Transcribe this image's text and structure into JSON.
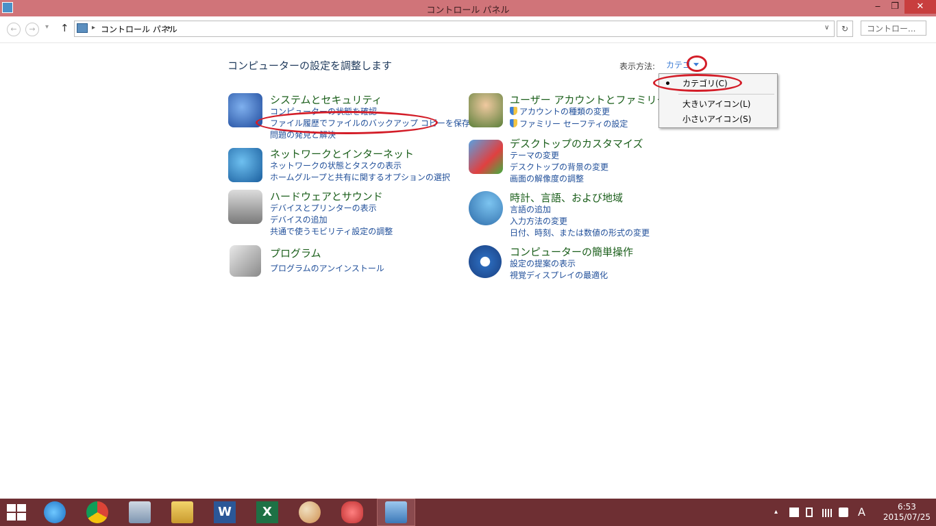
{
  "window": {
    "title": "コントロール パネル",
    "minimize": "‒",
    "restore": "❐",
    "close": "✕"
  },
  "navbar": {
    "back": "←",
    "forward": "→",
    "recent": "▾",
    "up": "↑",
    "breadcrumb_sep": "▸",
    "breadcrumb": "コントロール パネル",
    "address_dropdown": "∨",
    "refresh": "↻",
    "search_placeholder": "コントロー..."
  },
  "heading": "コンピューターの設定を調整します",
  "viewby": {
    "label": "表示方法:",
    "value": "カテゴ",
    "options": [
      "カテゴリ(C)",
      "大きいアイコン(L)",
      "小さいアイコン(S)"
    ],
    "selected_index": 0
  },
  "categories": [
    {
      "title": "システムとセキュリティ",
      "links": [
        "コンピューターの状態を確認",
        "ファイル履歴でファイルのバックアップ コピーを保存",
        "問題の発見と解決"
      ]
    },
    {
      "title": "ネットワークとインターネット",
      "links": [
        "ネットワークの状態とタスクの表示",
        "ホームグループと共有に関するオプションの選択"
      ]
    },
    {
      "title": "ハードウェアとサウンド",
      "links": [
        "デバイスとプリンターの表示",
        "デバイスの追加",
        "共通で使うモビリティ設定の調整"
      ]
    },
    {
      "title": "プログラム",
      "links": [
        "プログラムのアンインストール"
      ]
    },
    {
      "title": "ユーザー アカウントとファミリー セーフ",
      "links": [
        "アカウントの種類の変更",
        "ファミリー セーフティの設定"
      ]
    },
    {
      "title": "デスクトップのカスタマイズ",
      "links": [
        "テーマの変更",
        "デスクトップの背景の変更",
        "画面の解像度の調整"
      ]
    },
    {
      "title": "時計、言語、および地域",
      "links": [
        "言語の追加",
        "入力方法の変更",
        "日付、時刻、または数値の形式の変更"
      ]
    },
    {
      "title": "コンピューターの簡単操作",
      "links": [
        "設定の提案の表示",
        "視覚ディスプレイの最適化"
      ]
    }
  ],
  "taskbar": {
    "apps": [
      "windows-start",
      "internet-explorer",
      "chrome",
      "file-explorer-photos",
      "file-explorer",
      "word",
      "excel",
      "paint",
      "snipping-tool",
      "control-panel"
    ],
    "word_letter": "W",
    "excel_letter": "X",
    "tray_arrow": "▴",
    "ime": "A",
    "time": "6:53",
    "date": "2015/07/25"
  },
  "colors": {
    "titlebar": "#d07479",
    "taskbar": "#6e2f33",
    "link": "#1f4e99",
    "category": "#1a5e1a",
    "annotation": "#d31d28"
  }
}
